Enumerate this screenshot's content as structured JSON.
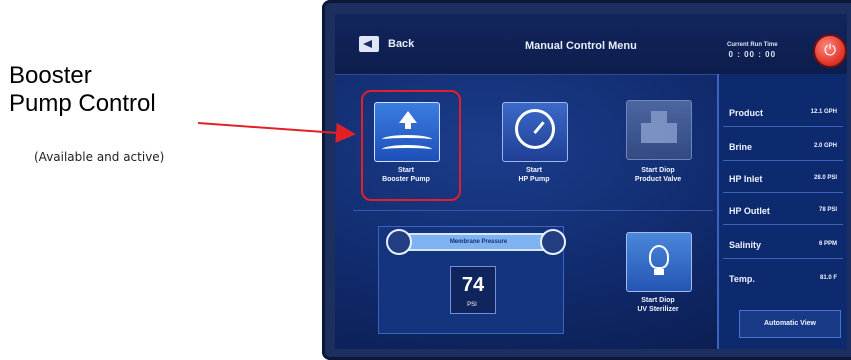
{
  "annotation": {
    "title_line1": "Booster",
    "title_line2": "Pump Control",
    "subtitle": "(Available and active)",
    "highlight_color": "#e22026"
  },
  "topbar": {
    "back_label": "Back",
    "title": "Manual Control Menu",
    "clock_label": "Current Run Time",
    "clock_value": "0 : 00 : 00",
    "power_icon": "power-icon"
  },
  "tiles": {
    "booster": {
      "line1": "Start",
      "line2": "Booster Pump",
      "icon": "water-pump-icon"
    },
    "hp": {
      "line1": "Start",
      "line2": "HP Pump",
      "icon": "gauge-icon"
    },
    "valve": {
      "line1": "Start Diop",
      "line2": "Product Valve",
      "icon": "valve-icon"
    },
    "uv": {
      "line1": "Start Diop",
      "line2": "UV Sterilizer",
      "icon": "light-bulb-icon"
    }
  },
  "pressure": {
    "label": "Membrane Pressure",
    "value": "74",
    "unit": "PSI"
  },
  "readings": [
    {
      "label": "Product",
      "value": "12.1 GPH"
    },
    {
      "label": "Brine",
      "value": "2.0 GPH"
    },
    {
      "label": "HP Inlet",
      "value": "28.0 PSI"
    },
    {
      "label": "HP Outlet",
      "value": "78 PSI"
    },
    {
      "label": "Salinity",
      "value": "6 PPM"
    },
    {
      "label": "Temp.",
      "value": "81.0 F"
    }
  ],
  "automatic_button": "Automatic View",
  "colors": {
    "screen_bg": "#0f2868",
    "accent": "#3b7de0",
    "power": "#e43b2f"
  }
}
